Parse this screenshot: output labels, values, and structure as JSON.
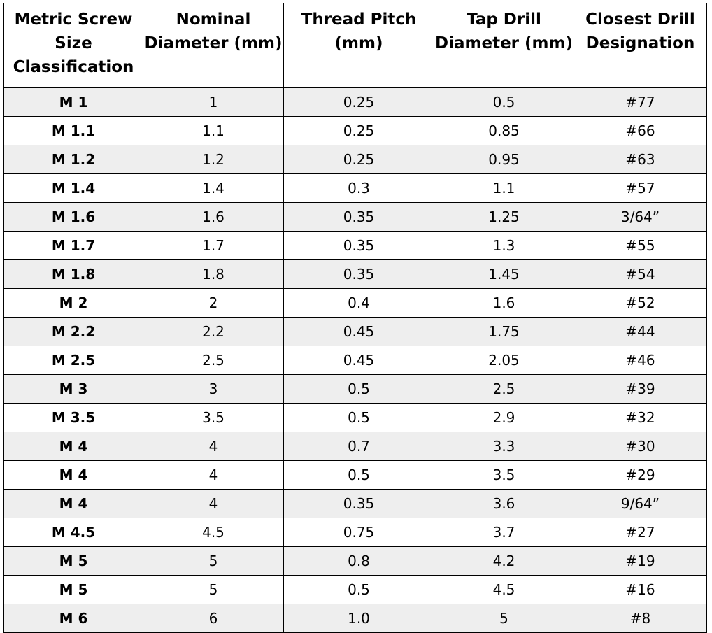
{
  "table": {
    "headers": [
      "Metric Screw Size Classification",
      "Nominal Diameter (mm)",
      "Thread Pitch (mm)",
      "Tap Drill Diameter (mm)",
      "Closest Drill Designation"
    ],
    "rows": [
      [
        "M 1",
        "1",
        "0.25",
        "0.5",
        "#77"
      ],
      [
        "M 1.1",
        "1.1",
        "0.25",
        "0.85",
        "#66"
      ],
      [
        "M 1.2",
        "1.2",
        "0.25",
        "0.95",
        "#63"
      ],
      [
        "M 1.4",
        "1.4",
        "0.3",
        "1.1",
        "#57"
      ],
      [
        "M 1.6",
        "1.6",
        "0.35",
        "1.25",
        "3/64”"
      ],
      [
        "M 1.7",
        "1.7",
        "0.35",
        "1.3",
        "#55"
      ],
      [
        "M 1.8",
        "1.8",
        "0.35",
        "1.45",
        "#54"
      ],
      [
        "M 2",
        "2",
        "0.4",
        "1.6",
        "#52"
      ],
      [
        "M 2.2",
        "2.2",
        "0.45",
        "1.75",
        "#44"
      ],
      [
        "M 2.5",
        "2.5",
        "0.45",
        "2.05",
        "#46"
      ],
      [
        "M 3",
        "3",
        "0.5",
        "2.5",
        "#39"
      ],
      [
        "M 3.5",
        "3.5",
        "0.5",
        "2.9",
        "#32"
      ],
      [
        "M 4",
        "4",
        "0.7",
        "3.3",
        "#30"
      ],
      [
        "M 4",
        "4",
        "0.5",
        "3.5",
        "#29"
      ],
      [
        "M 4",
        "4",
        "0.35",
        "3.6",
        "9/64”"
      ],
      [
        "M 4.5",
        "4.5",
        "0.75",
        "3.7",
        "#27"
      ],
      [
        "M 5",
        "5",
        "0.8",
        "4.2",
        "#19"
      ],
      [
        "M 5",
        "5",
        "0.5",
        "4.5",
        "#16"
      ],
      [
        "M 6",
        "6",
        "1.0",
        "5",
        "#8"
      ]
    ],
    "stripe_color": "#eeeeee"
  }
}
